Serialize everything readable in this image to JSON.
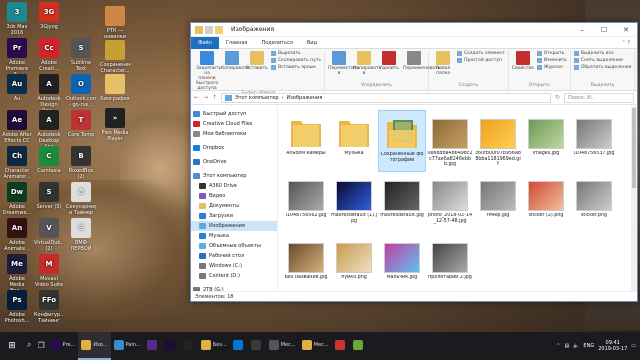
{
  "desktop_icons": [
    {
      "label": "3ds Max 2016",
      "color": "#1b8a8f",
      "glyph": "3"
    },
    {
      "label": "3Gjyog",
      "color": "#d1301f",
      "glyph": "3G"
    },
    {
      "label": "Adobe Premiere P...",
      "color": "#2a0b4e",
      "glyph": "Pr"
    },
    {
      "label": "Adobe Creati...",
      "color": "#d2232a",
      "glyph": "Cc"
    },
    {
      "label": "Au",
      "color": "#0a2d4a",
      "glyph": "Au"
    },
    {
      "label": "Autodesk Design Rev...",
      "color": "#202020",
      "glyph": "A"
    },
    {
      "label": "Adobe After Effects CC",
      "color": "#1f0a3a",
      "glyph": "Ae"
    },
    {
      "label": "Autodesk Desktop App",
      "color": "#222",
      "glyph": "A"
    },
    {
      "label": "Character Animator...",
      "color": "#0f2740",
      "glyph": "Ch"
    },
    {
      "label": "Camtasia",
      "color": "#1b8a3a",
      "glyph": "C"
    },
    {
      "label": "Adobe Dreamwe...",
      "color": "#0b3d1f",
      "glyph": "Dw"
    },
    {
      "label": "Server (S)",
      "color": "#333",
      "glyph": "S"
    },
    {
      "label": "Adobe Animate...",
      "color": "#311",
      "glyph": "An"
    },
    {
      "label": "VirtualDub... (2)",
      "color": "#555",
      "glyph": "V"
    },
    {
      "label": "Adobe Media Enc...",
      "color": "#1c1e3a",
      "glyph": "Me"
    },
    {
      "label": "Movavi Video Suite",
      "color": "#c62b2b",
      "glyph": "M"
    },
    {
      "label": "Adobe Photosh...",
      "color": "#071e3a",
      "glyph": "Ps"
    },
    {
      "label": "Конфигур... Тайнинг",
      "color": "#333",
      "glyph": "FFo"
    }
  ],
  "desktop_col2": [
    {
      "label": "Sublime Text",
      "color": "#555",
      "glyph": "S"
    },
    {
      "label": "Outlook.com - go-rus...",
      "color": "#0b63b5",
      "glyph": "O"
    },
    {
      "label": "Core Temp",
      "color": "#b33",
      "glyph": "T"
    },
    {
      "label": "BoxedBox (2)",
      "color": "#333",
      "glyph": "B"
    },
    {
      "label": "Секундомер и Таймер",
      "color": "#ddd",
      "glyph": "⏱"
    },
    {
      "label": "BMФ ПЕРВОЙ",
      "color": "#ddd",
      "glyph": "☰"
    }
  ],
  "desktop_col3": [
    {
      "label": "РТК — новинки",
      "color": "#c84",
      "glyph": ""
    },
    {
      "label": "Сохранение Character...",
      "color": "#c7a035",
      "glyph": ""
    },
    {
      "label": "Биография",
      "color": "#e8c068",
      "glyph": ""
    },
    {
      "label": "Plex Media Player",
      "color": "#222",
      "glyph": "»"
    }
  ],
  "window": {
    "title": "Изображения",
    "tabs": [
      "Файл",
      "Главная",
      "Поделиться",
      "Вид"
    ],
    "ribbon_groups": [
      {
        "name": "Буфер обмена",
        "big": [
          "Закрепить на панели быстрого доступа",
          "Копировать",
          "Вставить"
        ],
        "small": [
          "Вырезать",
          "Скопировать путь",
          "Вставить ярлык"
        ]
      },
      {
        "name": "Упорядочить",
        "big": [
          "Переместить в",
          "Копировать в",
          "Удалить",
          "Переименовать"
        ],
        "small": []
      },
      {
        "name": "Создать",
        "big": [
          "Новая папка"
        ],
        "small": [
          "Создать элемент",
          "Простой доступ"
        ]
      },
      {
        "name": "Открыть",
        "big": [
          "Свойства"
        ],
        "small": [
          "Открыть",
          "Изменить",
          "Журнал"
        ]
      },
      {
        "name": "Выделить",
        "big": [],
        "small": [
          "Выделить все",
          "Снять выделение",
          "Обратить выделение"
        ]
      }
    ],
    "address": [
      "Этот компьютер",
      "Изображения"
    ],
    "search_placeholder": "Поиск: И...",
    "nav": [
      {
        "label": "Быстрый доступ",
        "color": "#3c8adb"
      },
      {
        "label": "Creative Cloud Files",
        "color": "#d2232a"
      },
      {
        "label": "Мои библиотеки",
        "color": "#888"
      },
      {
        "gap": true
      },
      {
        "label": "Dropbox",
        "color": "#1081de"
      },
      {
        "gap": true
      },
      {
        "label": "OneDrive",
        "color": "#2a72c8"
      },
      {
        "gap": true
      },
      {
        "label": "Этот компьютер",
        "color": "#4a90d0"
      },
      {
        "label": "A360 Drive",
        "color": "#333"
      },
      {
        "label": "Видео",
        "color": "#8855c8"
      },
      {
        "label": "Документы",
        "color": "#e0c060"
      },
      {
        "label": "Загрузки",
        "color": "#2a80d0"
      },
      {
        "label": "Изображения",
        "color": "#5aaadf",
        "sel": true
      },
      {
        "label": "Музыка",
        "color": "#2a80d0"
      },
      {
        "label": "Объемные объекты",
        "color": "#5ab0e0"
      },
      {
        "label": "Рабочий стол",
        "color": "#2a70c0"
      },
      {
        "label": "Windows (C:)",
        "color": "#777"
      },
      {
        "label": "Content (D:)",
        "color": "#777"
      },
      {
        "gap": true
      },
      {
        "label": "2TB (G:)",
        "color": "#777"
      },
      {
        "gap": true
      },
      {
        "label": "Content (D:)",
        "color": "#777"
      }
    ],
    "files": [
      {
        "name": "Альбом камеры",
        "kind": "folder"
      },
      {
        "name": "Музыка",
        "kind": "folder"
      },
      {
        "name": "Сохраненные фотографии",
        "kind": "folder-photo",
        "sel": true
      },
      {
        "name": "0e8ddba486498c2c77ae6a8246ebbb.jpg",
        "kind": "img",
        "c1": "#8a6a3a",
        "c2": "#c8a060"
      },
      {
        "name": "360fb00f07b956a88bba1181969ed.gif",
        "kind": "img",
        "c1": "#f0a020",
        "c2": "#ffd050"
      },
      {
        "name": "images.jpg",
        "kind": "img",
        "c1": "#6a9a5a",
        "c2": "#c0d8a0"
      },
      {
        "name": "l1048756537.jpg",
        "kind": "img",
        "c1": "#777",
        "c2": "#ccc"
      },
      {
        "name": "l1048756562.jpg",
        "kind": "img",
        "c1": "#555",
        "c2": "#aaa"
      },
      {
        "name": "maxresdefault (1).jpg",
        "kind": "img",
        "c1": "#0a0a30",
        "c2": "#3060e0"
      },
      {
        "name": "maxresdefault.jpg",
        "kind": "img",
        "c1": "#222",
        "c2": "#666"
      },
      {
        "name": "photo_2018-02-14_12-57-48.jpg",
        "kind": "img",
        "c1": "#888",
        "c2": "#ddd"
      },
      {
        "name": "rMAql.jpg",
        "kind": "img",
        "c1": "#777",
        "c2": "#bbb"
      },
      {
        "name": "sticker (2).png",
        "kind": "img",
        "c1": "#d04a30",
        "c2": "#f0c0a0"
      },
      {
        "name": "sticker.png",
        "kind": "img",
        "c1": "#777",
        "c2": "#ccc"
      },
      {
        "name": "Без названия.jpg",
        "kind": "img",
        "c1": "#6a4a2a",
        "c2": "#d8b080"
      },
      {
        "name": "пуйко.png",
        "kind": "img",
        "c1": "#c89a50",
        "c2": "#f0e0c0"
      },
      {
        "name": "мальчик.jpg",
        "kind": "img",
        "c1": "#c040a0",
        "c2": "#60c0f0"
      },
      {
        "name": "пролетарий 2.jpg",
        "kind": "img",
        "c1": "#444",
        "c2": "#aaa"
      }
    ],
    "status": "Элементов: 18"
  },
  "taskbar": {
    "buttons": [
      {
        "label": "Pre...",
        "color": "#2a0b4e"
      },
      {
        "label": "Изо...",
        "color": "#e0b040",
        "active": true
      },
      {
        "label": "Pain...",
        "color": "#3a8ad0"
      },
      {
        "label": "",
        "color": "#5a2a8a"
      },
      {
        "label": "",
        "color": "#1f0a3a"
      },
      {
        "label": "",
        "color": "#222"
      },
      {
        "label": "Без...",
        "color": "#e0b040"
      },
      {
        "label": "",
        "color": "#0078d7"
      },
      {
        "label": "",
        "color": "#3a3a3a"
      },
      {
        "label": "Мес...",
        "color": "#555"
      },
      {
        "label": "Мес...",
        "color": "#e0b040"
      },
      {
        "label": "",
        "color": "#c33"
      },
      {
        "label": "",
        "color": "#6a3"
      }
    ],
    "lang": "ENG",
    "time": "09:41",
    "date": "2019-03-17"
  }
}
